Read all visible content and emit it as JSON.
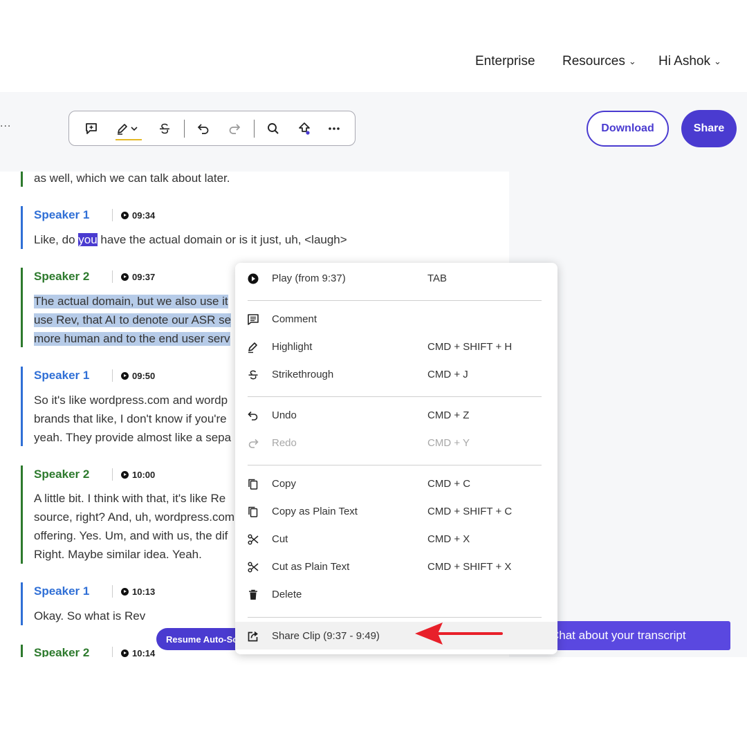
{
  "nav": {
    "enterprise": "Enterprise",
    "resources": "Resources",
    "user": "Hi Ashok"
  },
  "toolbar": {
    "more_left": "...",
    "download_label": "Download",
    "share_label": "Share",
    "icons": [
      "add-comment-icon",
      "highlight-icon",
      "chevron-down-icon",
      "strikethrough-icon",
      "undo-icon",
      "redo-icon",
      "search-icon",
      "upload-icon",
      "more-icon"
    ]
  },
  "transcript": {
    "blocks": [
      {
        "speaker": "",
        "time": "",
        "lines": [
          "as well, which we can talk about later."
        ]
      },
      {
        "speaker": "Speaker 1",
        "time": "09:34",
        "lines": [
          "Like, do ",
          "you",
          " have the actual domain or is it just, uh, <laugh>"
        ]
      },
      {
        "speaker": "Speaker 2",
        "time": "09:37",
        "lines": [
          "The actual domain, but we also use it",
          "use Rev, that AI to denote our ASR se",
          "more human and to the end user serv"
        ]
      },
      {
        "speaker": "Speaker 1",
        "time": "09:50",
        "lines": [
          "So it's like wordpress.com and wordp",
          "brands that like, I don't know if you're",
          "yeah. They provide almost like a sepa"
        ]
      },
      {
        "speaker": "Speaker 2",
        "time": "10:00",
        "lines": [
          "A little bit. I think with that, it's like Re",
          "source, right? And, uh, wordpress.com",
          "offering. Yes. Um, and with us, the dif",
          "Right. Maybe similar idea. Yeah."
        ]
      },
      {
        "speaker": "Speaker 1",
        "time": "10:13",
        "lines": [
          "Okay. So what is Rev"
        ]
      },
      {
        "speaker": "Speaker 2",
        "time": "10:14",
        "lines": []
      }
    ],
    "resume_label": "Resume Auto-Scroll",
    "chat_label": "Chat about your transcript"
  },
  "menu": {
    "items": [
      {
        "label": "Play (from 9:37)",
        "shortcut": "TAB",
        "icon": "play-circle-icon"
      },
      {
        "label": "Comment",
        "shortcut": "",
        "icon": "comment-icon"
      },
      {
        "label": "Highlight",
        "shortcut": "CMD + SHIFT + H",
        "icon": "highlight-icon"
      },
      {
        "label": "Strikethrough",
        "shortcut": "CMD + J",
        "icon": "strikethrough-icon"
      },
      {
        "label": "Undo",
        "shortcut": "CMD + Z",
        "icon": "undo-icon"
      },
      {
        "label": "Redo",
        "shortcut": "CMD + Y",
        "icon": "redo-icon",
        "disabled": true
      },
      {
        "label": "Copy",
        "shortcut": "CMD + C",
        "icon": "copy-icon"
      },
      {
        "label": "Copy as Plain Text",
        "shortcut": "CMD + SHIFT + C",
        "icon": "copy-icon"
      },
      {
        "label": "Cut",
        "shortcut": "CMD + X",
        "icon": "scissors-icon"
      },
      {
        "label": "Cut as Plain Text",
        "shortcut": "CMD + SHIFT + X",
        "icon": "scissors-icon"
      },
      {
        "label": "Delete",
        "shortcut": "",
        "icon": "trash-icon"
      },
      {
        "label": "Share Clip (9:37 - 9:49)",
        "shortcut": "",
        "icon": "share-icon",
        "hovered": true
      }
    ]
  },
  "colors": {
    "accent": "#4a3bd0",
    "speaker1": "#2f6fd6",
    "speaker2": "#2d7a2d",
    "selection": "#b6cbe8",
    "highlight_underline": "#e5b825",
    "annotation_arrow": "#e8202a"
  }
}
